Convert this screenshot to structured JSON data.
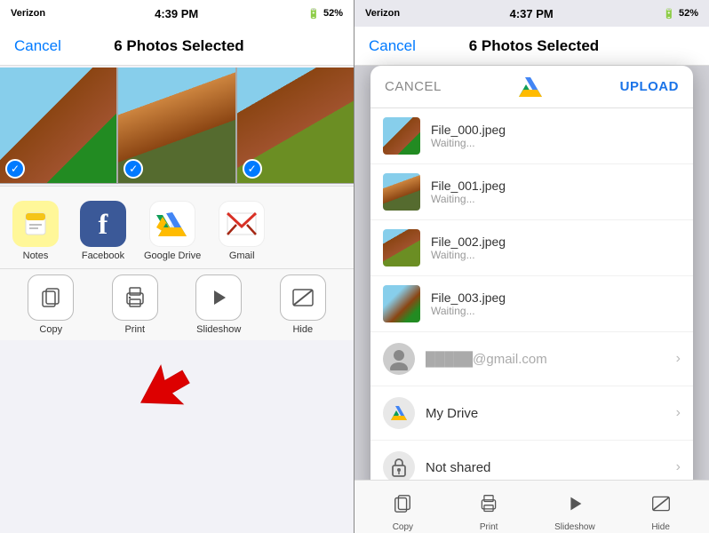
{
  "left_phone": {
    "status_bar": {
      "carrier": "Verizon",
      "time": "4:39 PM",
      "battery": "52%"
    },
    "nav": {
      "cancel": "Cancel",
      "title": "6 Photos Selected"
    },
    "apps": [
      {
        "id": "notes",
        "label": "Notes",
        "icon_type": "notes"
      },
      {
        "id": "facebook",
        "label": "Facebook",
        "icon_type": "facebook"
      },
      {
        "id": "googledrive",
        "label": "Google Drive",
        "icon_type": "gdrive"
      },
      {
        "id": "gmail",
        "label": "Gmail",
        "icon_type": "gmail"
      }
    ],
    "actions": [
      {
        "id": "copy",
        "label": "Copy",
        "icon": "📋"
      },
      {
        "id": "print",
        "label": "Print",
        "icon": "🖨"
      },
      {
        "id": "slideshow",
        "label": "Slideshow",
        "icon": "▶"
      },
      {
        "id": "hide",
        "label": "Hide",
        "icon": "⊘"
      }
    ]
  },
  "right_phone": {
    "status_bar": {
      "carrier": "Verizon",
      "time": "4:37 PM",
      "battery": "52%"
    },
    "nav": {
      "cancel": "Cancel",
      "title": "6 Photos Selected"
    },
    "modal": {
      "cancel_label": "CANCEL",
      "upload_label": "UPLOAD",
      "files": [
        {
          "name": "File_000.jpeg",
          "status": "Waiting..."
        },
        {
          "name": "File_001.jpeg",
          "status": "Waiting..."
        },
        {
          "name": "File_002.jpeg",
          "status": "Waiting..."
        },
        {
          "name": "File_003.jpeg",
          "status": "Waiting..."
        }
      ],
      "locations": [
        {
          "id": "account",
          "label": "@gmail.com",
          "icon": "👤"
        },
        {
          "id": "mydrive",
          "label": "My Drive",
          "icon": "📁"
        },
        {
          "id": "notshared",
          "label": "Not shared",
          "icon": "🔒"
        }
      ]
    },
    "bottom_actions": [
      {
        "id": "copy",
        "label": "Copy"
      },
      {
        "id": "print",
        "label": "Print"
      },
      {
        "id": "slideshow",
        "label": "Slideshow"
      },
      {
        "id": "hide",
        "label": "Hide"
      }
    ]
  }
}
